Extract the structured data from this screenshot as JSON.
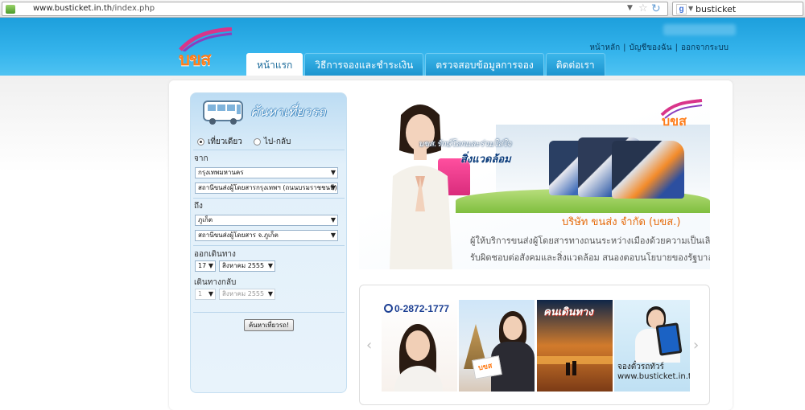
{
  "browser": {
    "url_host": "www.busticket.in.th",
    "url_path": "/index.php",
    "search_text": "busticket"
  },
  "header": {
    "logo_text": "บขส",
    "top_links": [
      "หน้าหลัก",
      "บัญชีของฉัน",
      "ออกจากระบบ"
    ],
    "tabs": [
      {
        "label": "หน้าแรก",
        "active": true
      },
      {
        "label": "วิธีการจองและชำระเงิน",
        "active": false
      },
      {
        "label": "ตรวจสอบข้อมูลการจอง",
        "active": false
      },
      {
        "label": "ติดต่อเรา",
        "active": false
      }
    ]
  },
  "search_panel": {
    "title": "ค้นหาเที่ยวรถ",
    "trip_types": [
      {
        "label": "เที่ยวเดียว",
        "selected": true
      },
      {
        "label": "ไป-กลับ",
        "selected": false
      }
    ],
    "from_label": "จาก",
    "from_province": "กรุงเทพมหานคร",
    "from_station": "สถานีขนส่งผู้โดยสารกรุงเทพฯ (ถนนบรมราชชนนี)",
    "to_label": "ถึง",
    "to_province": "ภูเก็ต",
    "to_station": "สถานีขนส่งผู้โดยสาร จ.ภูเก็ต",
    "depart_label": "ออกเดินทาง",
    "depart_day": "17",
    "depart_month": "สิงหาคม 2555",
    "return_label": "เดินทางกลับ",
    "return_day": "1",
    "return_month": "สิงหาคม 2555",
    "search_button": "ค้นหาเที่ยวรถ!"
  },
  "banner": {
    "logo_text": "บขส",
    "slogan_line1": "บขส.รักษ์โลกและร่วมใส่ใจ",
    "slogan_line2": "สิ่งแวดล้อม",
    "company": "บริษัท ขนส่ง จำกัด (บขส.)",
    "desc_line1": "ผู้ให้บริการขนส่งผู้โดยสารทางถนนระหว่างเมืองด้วยความเป็นเลิศ",
    "desc_line2": "รับผิดชอบต่อสังคมและสิ่งแวดล้อม สนองตอบนโยบายของรัฐบาล"
  },
  "carousel": {
    "phone": "0-2872-1777",
    "card2_logo": "บขส",
    "magazine_title": "คนเดินทาง",
    "card4_caption1": "จองตั๋วรถทัวร์",
    "card4_caption2": "www.busticket.in.th",
    "prev_arrow": "‹",
    "next_arrow": "›"
  },
  "colors": {
    "header_blue": "#29a9e6",
    "accent_orange": "#ff7d1a",
    "text_dark_blue": "#0c3d7c"
  }
}
